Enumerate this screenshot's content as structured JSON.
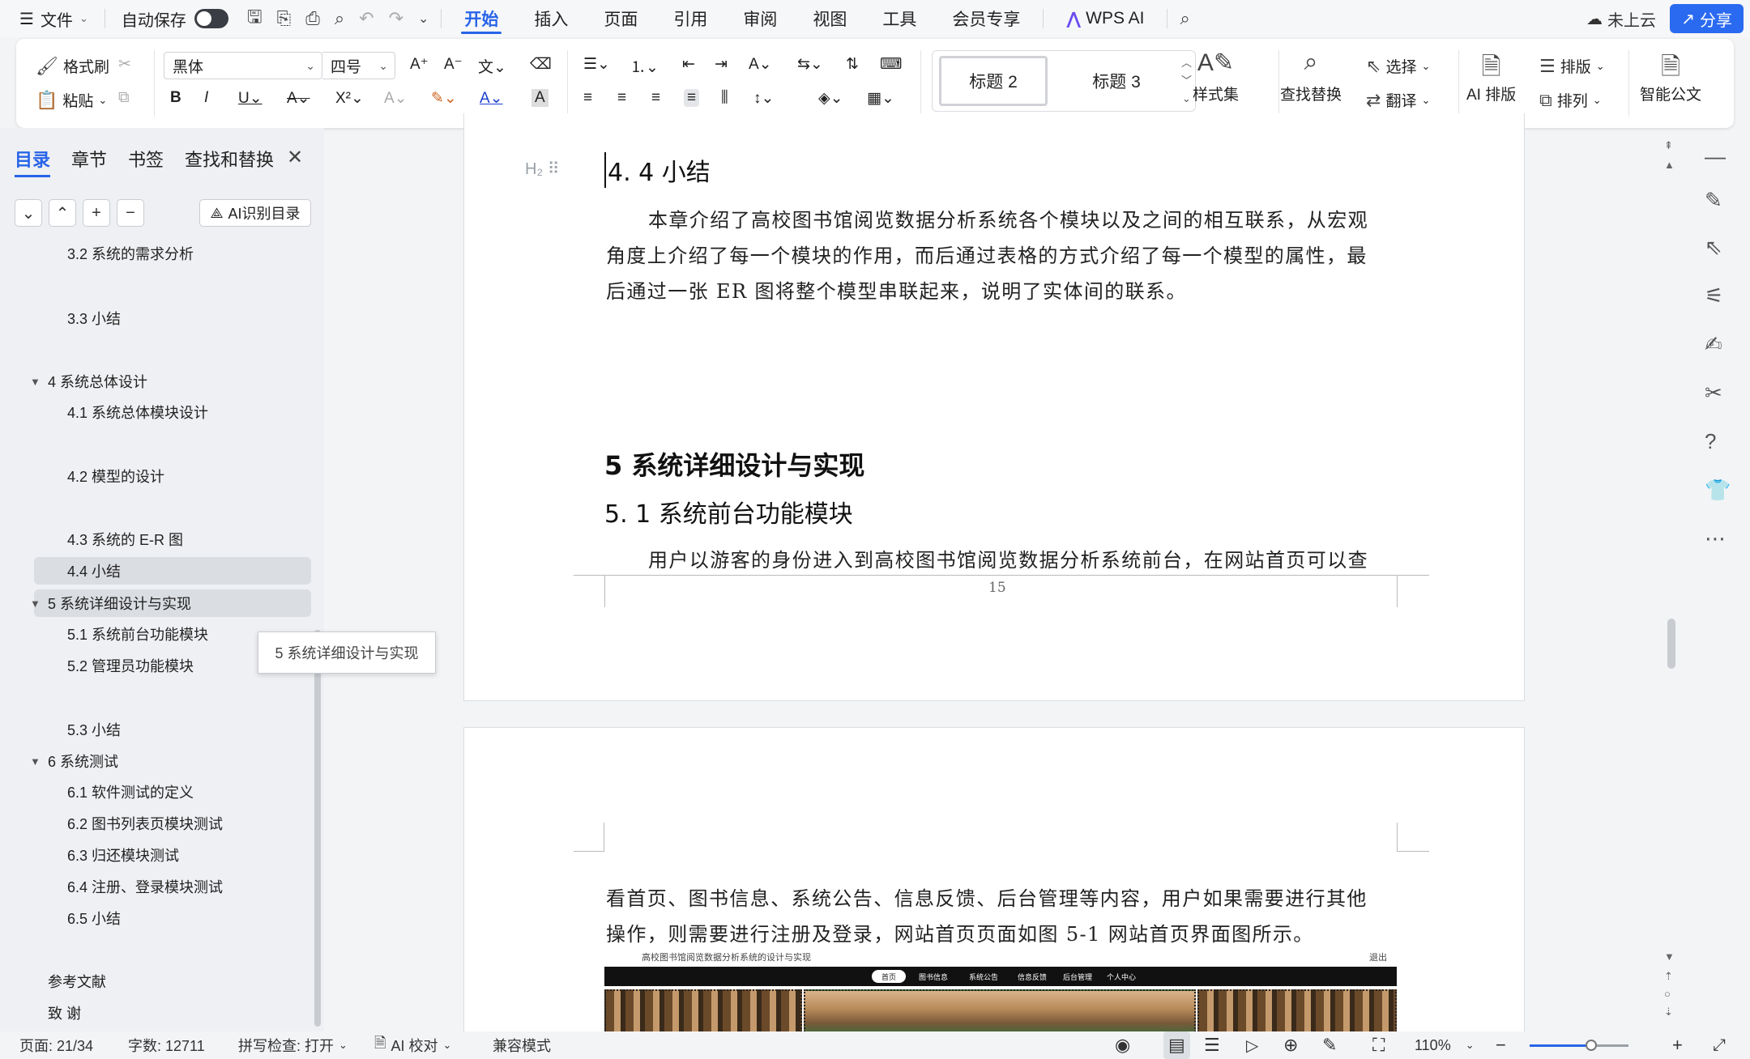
{
  "menubar": {
    "menu_icon": "hamburger-icon",
    "file": "文件",
    "autosave": "自动保存",
    "tabs": [
      "开始",
      "插入",
      "页面",
      "引用",
      "审阅",
      "视图",
      "工具",
      "会员专享",
      "WPS AI"
    ],
    "cloud": "未上云",
    "share": "分享"
  },
  "ribbon": {
    "format_painter": "格式刷",
    "paste": "粘贴",
    "font_name": "黑体",
    "font_size": "四号",
    "style_h2": "标题 2",
    "style_h3": "标题 3",
    "style_set": "样式集",
    "find_replace": "查找替换",
    "select": "选择",
    "translate": "翻译",
    "ai_layout": "AI 排版",
    "typeset": "排版",
    "arrange": "排列",
    "smart_doc": "智能公文"
  },
  "panel": {
    "tabs": [
      "目录",
      "章节",
      "书签",
      "查找和替换"
    ],
    "ai_toc": "AI识别目录",
    "toc": [
      {
        "label": "3.2 系统的需求分析",
        "level": 2
      },
      {
        "label": "3.3 小结",
        "level": 2
      },
      {
        "label": "4  系统总体设计",
        "level": 1,
        "expanded": true
      },
      {
        "label": "4.1 系统总体模块设计",
        "level": 2
      },
      {
        "label": "4.2 模型的设计",
        "level": 2
      },
      {
        "label": "4.3 系统的 E-R 图",
        "level": 2
      },
      {
        "label": "4.4 小结",
        "level": 2,
        "selected": true
      },
      {
        "label": "5  系统详细设计与实现",
        "level": 1,
        "expanded": true
      },
      {
        "label": "5.1 系统前台功能模块",
        "level": 2
      },
      {
        "label": "5.2 管理员功能模块",
        "level": 2
      },
      {
        "label": "5.3  小结",
        "level": 2
      },
      {
        "label": "6  系统测试",
        "level": 1,
        "expanded": true
      },
      {
        "label": "6.1 软件测试的定义",
        "level": 2
      },
      {
        "label": "6.2 图书列表页模块测试",
        "level": 2
      },
      {
        "label": "6.3 归还模块测试",
        "level": 2
      },
      {
        "label": "6.4 注册、登录模块测试",
        "level": 2
      },
      {
        "label": "6.5 小结",
        "level": 2
      },
      {
        "label": "参考文献",
        "level": 1
      },
      {
        "label": "致   谢",
        "level": 1
      }
    ],
    "tooltip": "5 系统详细设计与实现"
  },
  "document": {
    "h2_marker": "H₂",
    "sec44_title": "4. 4 小结",
    "sec44_lines": [
      "本章介绍了高校图书馆阅览数据分析系统各个模块以及之间的相互联系，从宏观",
      "角度上介绍了每一个模块的作用，而后通过表格的方式介绍了每一个模型的属性，最",
      "后通过一张 ER 图将整个模型串联起来，说明了实体间的联系。"
    ],
    "ch5_title": "5  系统详细设计与实现",
    "sec51_title": "5. 1 系统前台功能模块",
    "sec51_line1": "用户以游客的身份进入到高校图书馆阅览数据分析系统前台，在网站首页可以查",
    "page_number": "15",
    "page2_lines": [
      "看首页、图书信息、系统公告、信息反馈、后台管理等内容，用户如果需要进行其他",
      "操作，则需要进行注册及登录，网站首页页面如图 5-1 网站首页界面图所示。"
    ],
    "figure": {
      "title": "高校图书馆阅览数据分析系统的设计与实现",
      "nav": [
        "首页",
        "图书信息",
        "系统公告",
        "信息反馈",
        "后台管理",
        "个人中心"
      ],
      "login": "退出"
    }
  },
  "statusbar": {
    "page": "页面: 21/34",
    "words": "字数: 12711",
    "spell": "拼写检查: 打开",
    "ai_check": "AI 校对",
    "compat": "兼容模式",
    "zoom": "110%",
    "zoom_level": 0.62
  }
}
